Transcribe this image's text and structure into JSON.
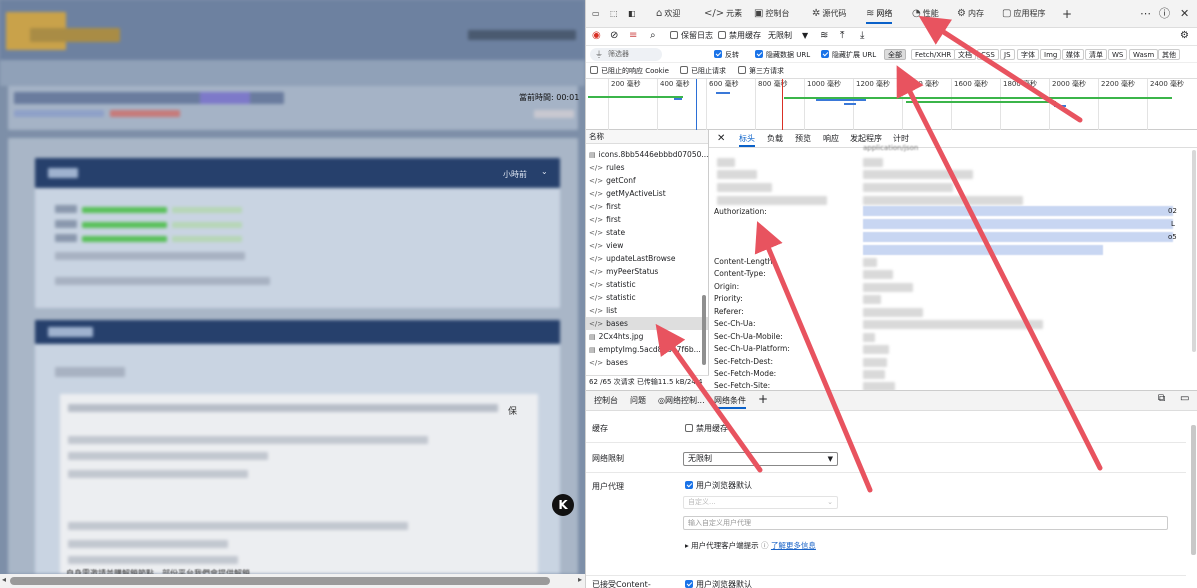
{
  "left_page": {
    "current_time_label": "當前時間: 00:01",
    "panel_header_text": "小時前",
    "footer_text": "自身需邀請並購解鎖節點，部份平台我們會提供解鎖"
  },
  "devtools": {
    "tabs": [
      {
        "icon": "home-icon",
        "label": "欢迎"
      },
      {
        "icon": "code-icon",
        "label": "元素"
      },
      {
        "icon": "console-icon",
        "label": "控制台"
      },
      {
        "icon": "bug-icon",
        "label": "源代码"
      },
      {
        "icon": "wifi-icon",
        "label": "网络"
      },
      {
        "icon": "gauge-icon",
        "label": "性能"
      },
      {
        "icon": "memory-icon",
        "label": "内存"
      },
      {
        "icon": "app-icon",
        "label": "应用程序"
      }
    ],
    "toolbar": {
      "preserve_log": "保留日志",
      "disable_cache": "禁用缓存",
      "throttle": "无限制"
    },
    "filter": {
      "placeholder": "筛选器",
      "invert": "反转",
      "hide_data_urls": "隐藏数据 URL",
      "hide_ext_urls": "隐藏扩展 URL",
      "types": [
        "全部",
        "Fetch/XHR",
        "文档",
        "CSS",
        "JS",
        "字体",
        "Img",
        "媒体",
        "清单",
        "WS",
        "Wasm",
        "其他"
      ],
      "blocked_cookies": "已阻止的响应 Cookie",
      "blocked_requests": "已阻止请求",
      "third_party": "第三方请求"
    },
    "timeline_ticks": [
      "200 毫秒",
      "400 毫秒",
      "600 毫秒",
      "800 毫秒",
      "1000 毫秒",
      "1200 毫秒",
      "1400 毫秒",
      "1600 毫秒",
      "1800 毫秒",
      "2000 毫秒",
      "2200 毫秒",
      "2400 毫秒"
    ],
    "request_list": {
      "header": "名称",
      "items": [
        {
          "type": "img",
          "name": "icons.8bb5446ebbbd07050..."
        },
        {
          "type": "xhr",
          "name": "rules"
        },
        {
          "type": "xhr",
          "name": "getConf"
        },
        {
          "type": "xhr",
          "name": "getMyActiveList"
        },
        {
          "type": "xhr",
          "name": "first"
        },
        {
          "type": "xhr",
          "name": "first"
        },
        {
          "type": "xhr",
          "name": "state"
        },
        {
          "type": "xhr",
          "name": "view"
        },
        {
          "type": "xhr",
          "name": "updateLastBrowse"
        },
        {
          "type": "xhr",
          "name": "myPeerStatus"
        },
        {
          "type": "xhr",
          "name": "statistic"
        },
        {
          "type": "xhr",
          "name": "statistic"
        },
        {
          "type": "xhr",
          "name": "list"
        },
        {
          "type": "xhr",
          "name": "bases"
        },
        {
          "type": "img",
          "name": "2Cx4hts.jpg"
        },
        {
          "type": "img",
          "name": "emptyImg.5acd87847f6b..."
        },
        {
          "type": "xhr",
          "name": "bases"
        }
      ],
      "status": "62 /65 次请求  已传输11.5 kB/24.4"
    },
    "details": {
      "tabs": [
        "标头",
        "负载",
        "预览",
        "响应",
        "发起程序",
        "计时"
      ],
      "top_value": "application/json",
      "headers": [
        "Authorization:",
        "Content-Length:",
        "Content-Type:",
        "Origin:",
        "Priority:",
        "Referer:",
        "Sec-Ch-Ua:",
        "Sec-Ch-Ua-Mobile:",
        "Sec-Ch-Ua-Platform:",
        "Sec-Fetch-Dest:",
        "Sec-Fetch-Mode:",
        "Sec-Fetch-Site:"
      ],
      "auth_tail": [
        "02",
        "L",
        "o5"
      ]
    },
    "drawer": {
      "tabs": [
        "控制台",
        "问题",
        "网络控制...",
        "网络条件"
      ],
      "cache_label": "缓存",
      "disable_cache": "禁用缓存",
      "throttle_label": "网络限制",
      "throttle_value": "无限制",
      "ua_label": "用户代理",
      "ua_default": "用户浏览器默认",
      "ua_custom_placeholder": "自定义...",
      "ua_input_placeholder": "输入自定义用户代理",
      "ua_hints": "用户代理客户端提示",
      "learn_more": "了解更多信息",
      "accepted_label": "已接受Content-",
      "accepted_default": "用户浏览器默认"
    }
  }
}
